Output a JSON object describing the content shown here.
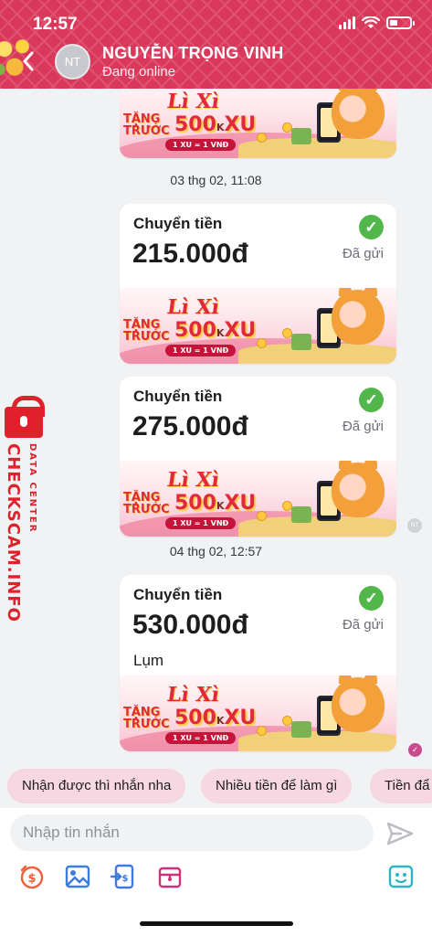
{
  "status_bar": {
    "time": "12:57"
  },
  "header": {
    "avatar_initials": "NT",
    "contact_name": "NGUYỄN TRỌNG VINH",
    "contact_status": "Đang online"
  },
  "banner": {
    "headline": "Lì Xì",
    "tang_line1": "TẶNG",
    "tang_line2": "TRƯỚC",
    "amount": "500",
    "amount_unit": "K",
    "currency": "XU",
    "rate": "1 XU = 1 VNĐ"
  },
  "messages": {
    "separator_1": "03 thg 02, 11:08",
    "separator_2": "04 thg 02, 12:57",
    "transfers": [
      {
        "title": "Chuyển tiền",
        "amount": "215.000đ",
        "status": "Đã gửi",
        "note": ""
      },
      {
        "title": "Chuyển tiền",
        "amount": "275.000đ",
        "status": "Đã gửi",
        "note": ""
      },
      {
        "title": "Chuyển tiền",
        "amount": "530.000đ",
        "status": "Đã gửi",
        "note": "Lụm"
      }
    ],
    "mini_avatar": "NT"
  },
  "watermark": {
    "line1": "DATA CENTER",
    "line2": "CHECKSCAM.INFO"
  },
  "quick_replies": [
    "Nhận được thì nhắn nha",
    "Nhiều tiền để làm gì",
    "Tiền đẩ"
  ],
  "composer": {
    "placeholder": "Nhập tin nhắn",
    "value": ""
  },
  "colors": {
    "header": "#d9385a",
    "success": "#52b74b",
    "chip": "#f7d7e2",
    "accent": "#e0202a"
  },
  "icons": [
    "back-icon",
    "signal-icon",
    "wifi-icon",
    "battery-icon",
    "check-icon",
    "send-icon",
    "money-icon",
    "image-icon",
    "transfer-icon",
    "gift-icon",
    "sticker-icon"
  ]
}
